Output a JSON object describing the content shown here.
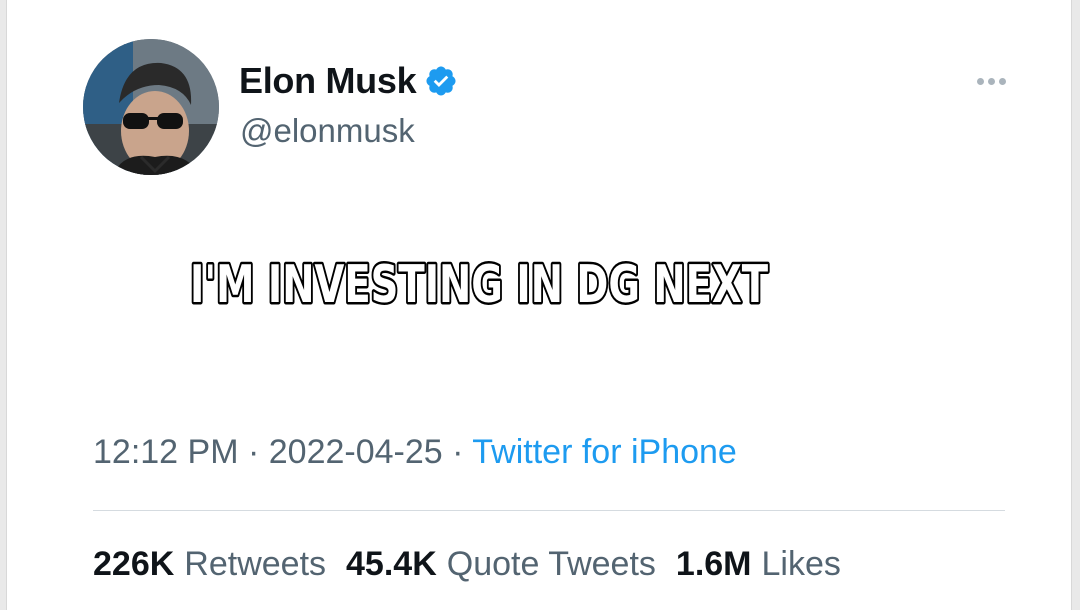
{
  "tweet": {
    "author": {
      "display_name": "Elon Musk",
      "handle": "@elonmusk",
      "verified": true,
      "avatar_icon": "profile-photo"
    },
    "more_icon": "ellipsis-icon",
    "overlay_text": "I'M INVESTING IN DG NEXT",
    "meta": {
      "time": "12:12 PM",
      "separator": " · ",
      "date": "2022-04-25",
      "source": "Twitter for iPhone"
    },
    "stats": {
      "retweets_count": "226K",
      "retweets_label": "Retweets",
      "quotes_count": "45.4K",
      "quotes_label": "Quote Tweets",
      "likes_count": "1.6M",
      "likes_label": "Likes"
    }
  },
  "colors": {
    "text_primary": "#0f1419",
    "text_secondary": "#536471",
    "link_blue": "#1d9bf0",
    "verified_blue": "#1d9bf0",
    "meme_text_fill": "#ffffff",
    "meme_text_stroke": "#000000"
  }
}
